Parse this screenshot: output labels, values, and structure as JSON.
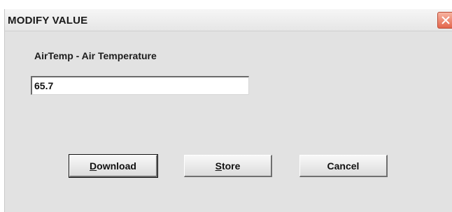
{
  "window": {
    "title": "MODIFY VALUE"
  },
  "form": {
    "field_label": "AirTemp - Air Temperature",
    "value": "65.7"
  },
  "buttons": {
    "download": {
      "mnemonic": "D",
      "rest": "ownload"
    },
    "store": {
      "mnemonic": "S",
      "rest": "tore"
    },
    "cancel": {
      "label": "Cancel"
    }
  },
  "icons": {
    "close": "close-icon"
  },
  "colors": {
    "close_button": "#e3664c",
    "dialog_background": "#e2e2e2"
  }
}
